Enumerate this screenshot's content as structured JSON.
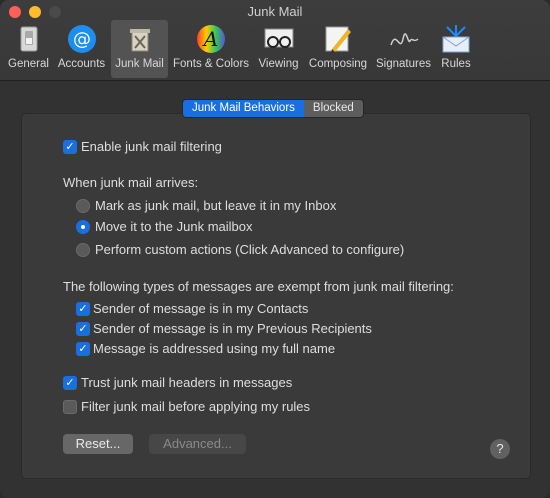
{
  "window": {
    "title": "Junk Mail"
  },
  "toolbar": {
    "tabs": [
      {
        "label": "General",
        "icon": "general-switch-icon"
      },
      {
        "label": "Accounts",
        "icon": "at-sign-icon"
      },
      {
        "label": "Junk Mail",
        "icon": "junk-trash-icon"
      },
      {
        "label": "Fonts & Colors",
        "icon": "color-a-icon"
      },
      {
        "label": "Viewing",
        "icon": "glasses-icon"
      },
      {
        "label": "Composing",
        "icon": "pencil-icon"
      },
      {
        "label": "Signatures",
        "icon": "signature-icon"
      },
      {
        "label": "Rules",
        "icon": "rules-envelope-icon"
      }
    ],
    "selected": "Junk Mail"
  },
  "segments": {
    "behaviors": "Junk Mail Behaviors",
    "blocked": "Blocked",
    "selected": "Junk Mail Behaviors"
  },
  "settings": {
    "enable_filtering": {
      "label": "Enable junk mail filtering",
      "checked": true
    },
    "arrives_heading": "When junk mail arrives:",
    "radio_options": [
      {
        "label": "Mark as junk mail, but leave it in my Inbox",
        "selected": false
      },
      {
        "label": "Move it to the Junk mailbox",
        "selected": true
      },
      {
        "label": "Perform custom actions (Click Advanced to configure)",
        "selected": false
      }
    ],
    "exempt_heading": "The following types of messages are exempt from junk mail filtering:",
    "exempt_options": [
      {
        "label": "Sender of message is in my Contacts",
        "checked": true
      },
      {
        "label": "Sender of message is in my Previous Recipients",
        "checked": true
      },
      {
        "label": "Message is addressed using my full name",
        "checked": true
      }
    ],
    "trust_headers": {
      "label": "Trust junk mail headers in messages",
      "checked": true
    },
    "filter_before_rules": {
      "label": "Filter junk mail before applying my rules",
      "checked": false
    }
  },
  "buttons": {
    "reset": "Reset...",
    "advanced": "Advanced...",
    "help": "?"
  },
  "colors": {
    "accent": "#1a6fe0",
    "background": "#323232",
    "panel": "#3a3a3a"
  }
}
